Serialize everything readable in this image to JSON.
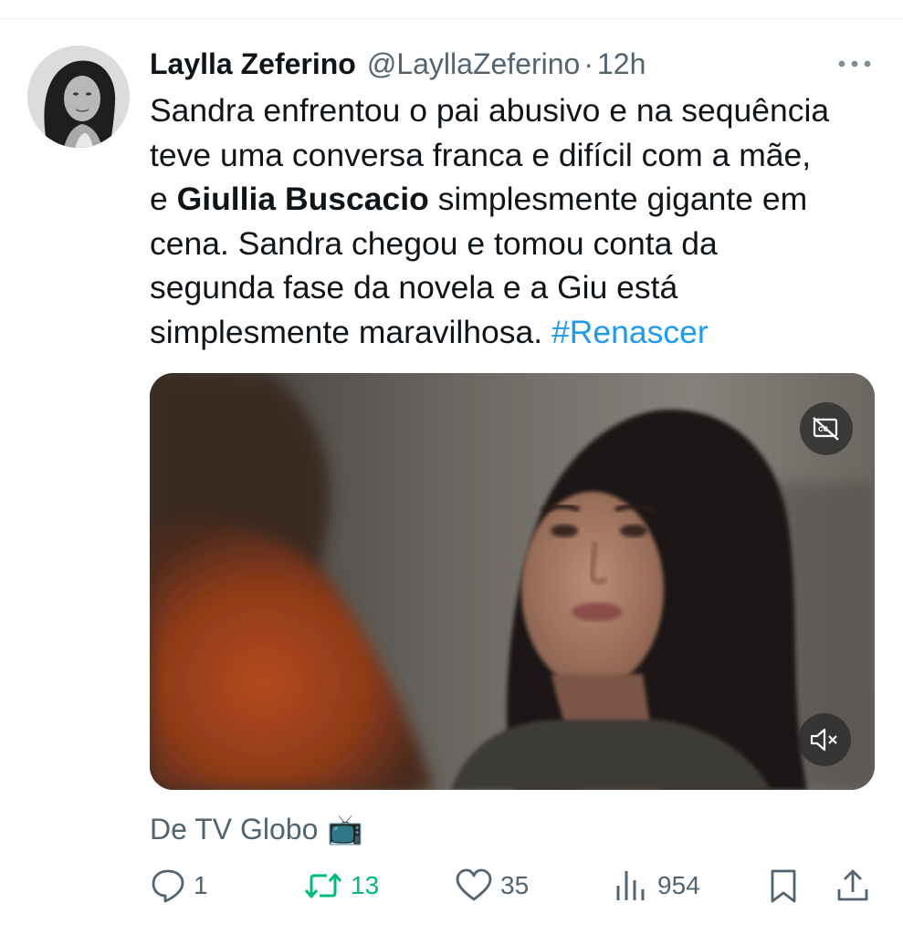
{
  "tweet": {
    "author": {
      "display_name": "Laylla Zeferino",
      "handle": "@LayllaZeferino",
      "separator": "·",
      "time": "12h"
    },
    "text_lines": [
      {
        "before": "Sandra enfrentou o pai abusivo e na sequência"
      },
      {
        "before": "teve uma conversa franca e difícil com a mãe,"
      },
      {
        "before": "e ",
        "bold": "Giullia Buscacio",
        "after": " simplesmente gigante em"
      },
      {
        "before": "cena. Sandra chegou e tomou conta da"
      },
      {
        "before": "segunda fase da novela e a Giu está"
      },
      {
        "before": "simplesmente maravilhosa. ",
        "hashtag": "#Renascer"
      }
    ],
    "source": {
      "label": "De TV Globo",
      "emoji": "📺"
    },
    "stats": {
      "replies": "1",
      "retweets": "13",
      "likes": "35",
      "views": "954"
    }
  },
  "icons": {
    "more": "more-horizontal-icon",
    "captions": "captions-off-icon",
    "mute": "speaker-muted-icon",
    "reply": "reply-icon",
    "retweet": "retweet-icon",
    "like": "heart-icon",
    "views": "views-bar-icon",
    "bookmark": "bookmark-icon",
    "share": "share-icon"
  },
  "colors": {
    "text": "#0f1419",
    "secondary": "#536471",
    "link": "#1d9bf0",
    "retweet_active": "#00ba7c"
  }
}
